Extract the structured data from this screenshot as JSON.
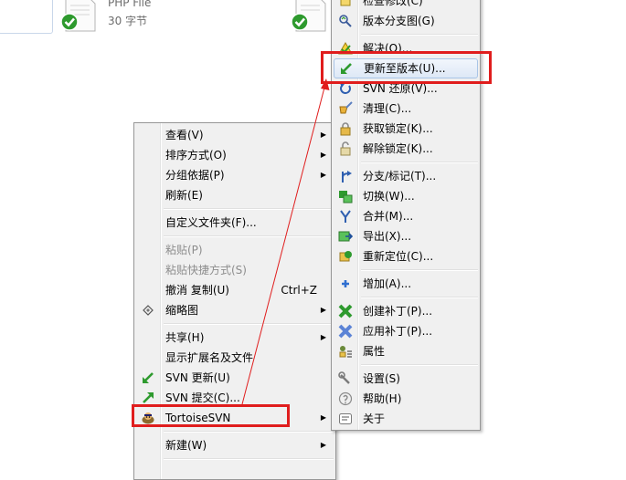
{
  "files": [
    {
      "name": "PHP File",
      "size": "30 字节"
    }
  ],
  "context_menu": {
    "items": [
      {
        "label": "查看(V)",
        "submenu": true
      },
      {
        "label": "排序方式(O)",
        "submenu": true
      },
      {
        "label": "分组依据(P)",
        "submenu": true
      },
      {
        "label": "刷新(E)"
      },
      {
        "label": "自定义文件夹(F)..."
      },
      {
        "label": "粘贴(P)",
        "disabled": true
      },
      {
        "label": "粘贴快捷方式(S)",
        "disabled": true
      },
      {
        "label": "撤消 复制(U)",
        "shortcut": "Ctrl+Z"
      },
      {
        "label": "缩略图",
        "submenu": true,
        "icon": "thumbnail-icon"
      },
      {
        "label": "共享(H)",
        "submenu": true
      },
      {
        "label": "显示扩展名及文件"
      },
      {
        "label": "SVN 更新(U)",
        "icon": "svn-update-icon"
      },
      {
        "label": "SVN 提交(C)...",
        "icon": "svn-commit-icon"
      },
      {
        "label": "TortoiseSVN",
        "submenu": true,
        "icon": "tortoisesvn-icon",
        "highlighted": true
      },
      {
        "label": "新建(W)",
        "submenu": true
      }
    ]
  },
  "svn_submenu": {
    "items": [
      {
        "label": "检查修改(C)",
        "icon": "check-modifications-icon"
      },
      {
        "label": "版本分支图(G)",
        "icon": "revision-graph-icon"
      },
      {
        "label": "解决(O)...",
        "icon": "resolve-icon"
      },
      {
        "label": "更新至版本(U)...",
        "icon": "update-to-revision-icon",
        "highlighted": true
      },
      {
        "label": "SVN 还原(V)...",
        "icon": "revert-icon"
      },
      {
        "label": "清理(C)...",
        "icon": "cleanup-icon"
      },
      {
        "label": "获取锁定(K)...",
        "icon": "get-lock-icon"
      },
      {
        "label": "解除锁定(K)...",
        "icon": "release-lock-icon"
      },
      {
        "label": "分支/标记(T)...",
        "icon": "branch-tag-icon"
      },
      {
        "label": "切换(W)...",
        "icon": "switch-icon"
      },
      {
        "label": "合并(M)...",
        "icon": "merge-icon"
      },
      {
        "label": "导出(X)...",
        "icon": "export-icon"
      },
      {
        "label": "重新定位(C)...",
        "icon": "relocate-icon"
      },
      {
        "label": "增加(A)...",
        "icon": "add-icon"
      },
      {
        "label": "创建补丁(P)...",
        "icon": "create-patch-icon"
      },
      {
        "label": "应用补丁(P)...",
        "icon": "apply-patch-icon"
      },
      {
        "label": "属性",
        "icon": "properties-icon"
      },
      {
        "label": "设置(S)",
        "icon": "settings-icon"
      },
      {
        "label": "帮助(H)",
        "icon": "help-icon"
      },
      {
        "label": "关于",
        "icon": "about-icon"
      }
    ]
  },
  "colors": {
    "annotation_red": "#e01d1d",
    "menu_background": "#f0f0f0",
    "highlight_border": "#a8c4e6",
    "svn_green": "#2e9a2e"
  }
}
